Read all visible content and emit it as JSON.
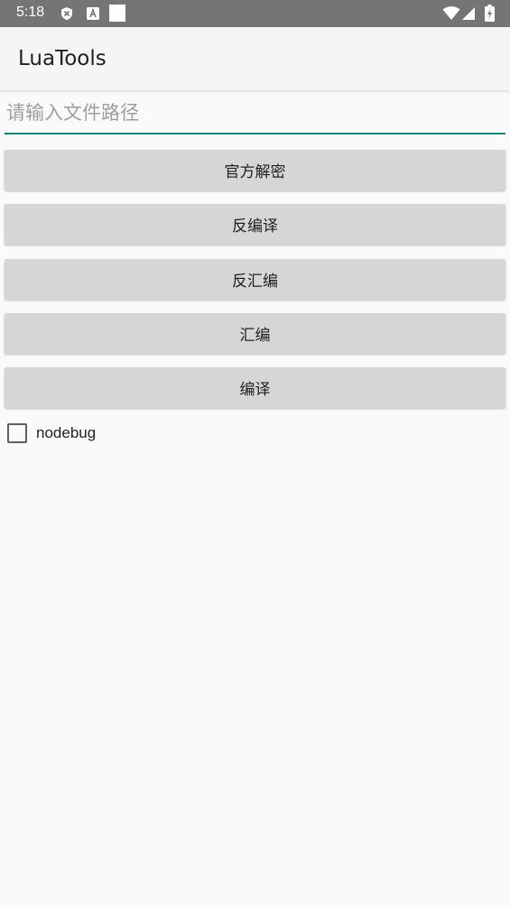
{
  "status_bar": {
    "time": "5:18",
    "icons": [
      "shield-x-icon",
      "a-box-icon",
      "white-square-icon",
      "wifi-icon",
      "signal-icon",
      "battery-charging-icon"
    ]
  },
  "app_bar": {
    "title": "LuaTools"
  },
  "path_input": {
    "placeholder": "请输入文件路径",
    "value": ""
  },
  "buttons": {
    "official_decrypt": "官方解密",
    "decompile": "反编译",
    "disassemble": "反汇编",
    "assemble": "汇编",
    "compile": "编译"
  },
  "nodebug": {
    "label": "nodebug",
    "checked": false
  },
  "colors": {
    "accent": "#008577",
    "status_bar": "#757575",
    "app_bar": "#f5f5f5",
    "button": "#d6d6d6",
    "background": "#fafafa"
  }
}
